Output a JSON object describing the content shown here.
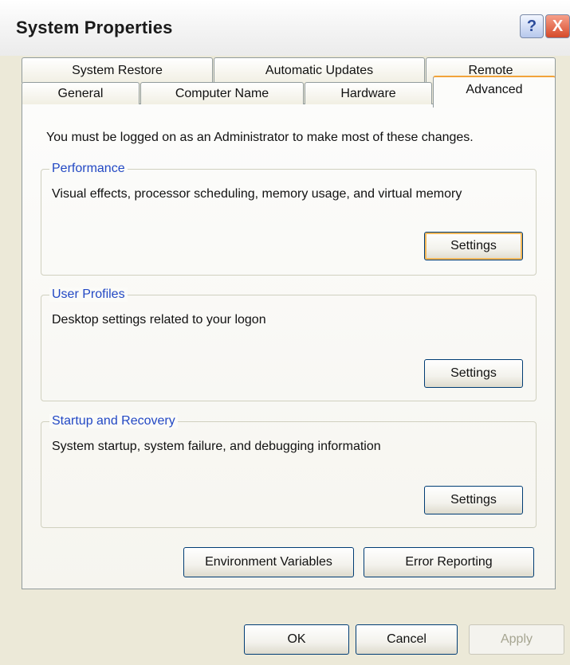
{
  "window": {
    "title": "System Properties",
    "help_label": "?",
    "close_label": "X"
  },
  "tabs": {
    "row_back": [
      "System Restore",
      "Automatic Updates",
      "Remote"
    ],
    "row_front": [
      "General",
      "Computer Name",
      "Hardware",
      "Advanced"
    ],
    "selected": "Advanced"
  },
  "panel": {
    "note": "You must be logged on as an Administrator to make most of these changes.",
    "groups": [
      {
        "label": "Performance",
        "description": "Visual effects, processor scheduling, memory usage, and virtual memory",
        "button_label": "Settings"
      },
      {
        "label": "User Profiles",
        "description": "Desktop settings related to your logon",
        "button_label": "Settings"
      },
      {
        "label": "Startup and Recovery",
        "description": "System startup, system failure, and debugging information",
        "button_label": "Settings"
      }
    ],
    "environment_variables_label": "Environment Variables",
    "error_reporting_label": "Error Reporting"
  },
  "footer": {
    "ok_label": "OK",
    "cancel_label": "Cancel",
    "apply_label": "Apply"
  }
}
